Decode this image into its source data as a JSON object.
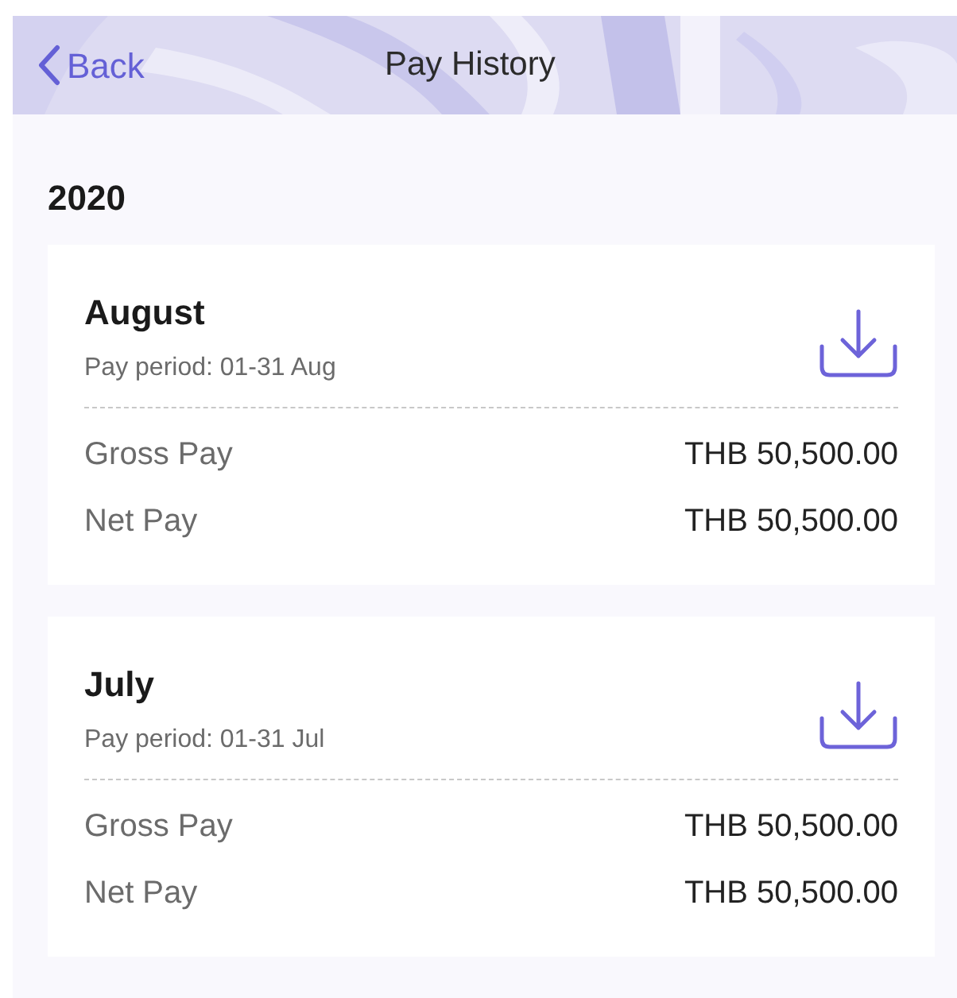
{
  "nav_bar": {
    "back": "Back",
    "title": "Pay History"
  },
  "year": "2020",
  "payslips": [
    {
      "month": "August",
      "period": "Pay period: 01-31 Aug",
      "lines": [
        {
          "label": "Gross Pay",
          "amount": "THB 50,500.00"
        },
        {
          "label": "Net Pay",
          "amount": "THB 50,500.00"
        }
      ]
    },
    {
      "month": "July",
      "period": "Pay period: 01-31 Jul",
      "lines": [
        {
          "label": "Gross Pay",
          "amount": "THB 50,500.00"
        },
        {
          "label": "Net Pay",
          "amount": "THB 50,500.00"
        }
      ]
    }
  ]
}
